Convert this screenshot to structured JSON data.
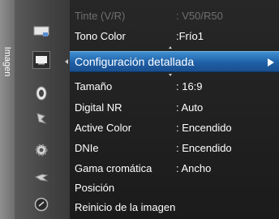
{
  "category_tab": {
    "label": "Imagen"
  },
  "icons": [
    "picture-settings-icon",
    "monitor-icon",
    "sound-icon",
    "channel-icon",
    "settings-gear-icon",
    "input-icon",
    "support-icon"
  ],
  "menu": {
    "rows_top": [
      {
        "label": "Tinte (V/R)",
        "value": ": V50/R50",
        "disabled": true
      },
      {
        "label": "Tono Color",
        "value": ":Frío1"
      }
    ],
    "highlighted": {
      "label": "Configuración detallada"
    },
    "rows_bottom": [
      {
        "label": "Tamaño",
        "value": ": 16:9"
      },
      {
        "label": "Digital NR",
        "value": ": Auto"
      },
      {
        "label": "Active Color",
        "value": ": Encendido"
      },
      {
        "label": "DNIe",
        "value": ": Encendido"
      },
      {
        "label": "Gama cromática",
        "value": ": Ancho"
      },
      {
        "label": "Posición",
        "value": ""
      },
      {
        "label": "Reinicio de la imagen",
        "value": ""
      }
    ]
  },
  "colors": {
    "highlight": "#2a75c0",
    "disabled_text": "#6f6f6f"
  }
}
